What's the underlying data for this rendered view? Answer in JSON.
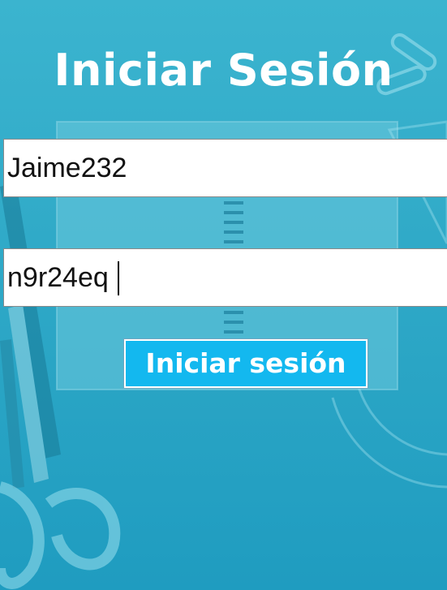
{
  "screen": {
    "title": "Iniciar Sesión"
  },
  "form": {
    "username_value": "Jaime232",
    "password_value": "n9r24eq",
    "submit_label": "Iniciar sesión"
  },
  "colors": {
    "background": "#2fa9c7",
    "button": "#13b8ef",
    "text_light": "#ffffff"
  },
  "decorations": [
    "notebook-illustration",
    "pencils-illustration",
    "paperclips-illustration",
    "protractor-illustration",
    "scissors-illustration"
  ]
}
